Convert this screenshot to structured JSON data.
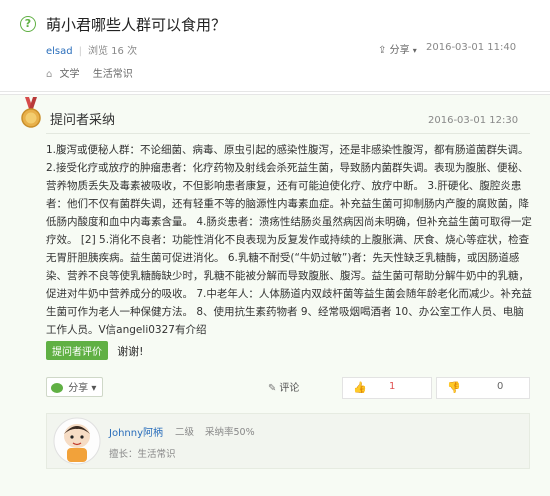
{
  "question": {
    "title": "萌小君哪些人群可以食用？",
    "user": "elsad",
    "views": "浏览 16 次",
    "share_label": "分享",
    "date": "2016-03-01 11:40",
    "tags": [
      "文学",
      "生活常识"
    ]
  },
  "answer": {
    "adopt_label": "提问者采纳",
    "date": "2016-03-01 12:30",
    "body": "1.腹泻或便秘人群：不论细菌、病毒、原虫引起的感染性腹泻，还是非感染性腹泻，都有肠道菌群失调。 2.接受化疗或放疗的肿瘤患者：化疗药物及射线会杀死益生菌，导致肠内菌群失调。表现为腹胀、便秘、营养物质丢失及毒素被吸收，不但影响患者康复，还有可能迫使化疗、放疗中断。 3.肝硬化、腹腔炎患者：他们不仅有菌群失调，还有轻重不等的脑源性内毒素血症。补充益生菌可抑制肠内产腹的腐败菌，降低肠内酸度和血中内毒素含量。 4.肠炎患者：溃疡性结肠炎虽然病因尚未明确，但补充益生菌可取得一定疗效。 [2] 5.消化不良者：功能性消化不良表现为反复发作或持续的上腹胀满、厌食、烧心等症状，检查无胃肝胆胰疾病。益生菌可促进消化。 6.乳糖不耐受(“牛奶过敏”)者：先天性缺乏乳糖酶，或因肠道感染、营养不良等使乳糖酶缺少时，乳糖不能被分解而导致腹胀、腹泻。益生菌可帮助分解牛奶中的乳糖，促进对牛奶中营养成分的吸收。 7.中老年人：人体肠道内双歧杆菌等益生菌会随年龄老化而减少。补充益生菌可作为老人一种保健方法。   8、使用抗生素药物者 9、经常吸烟喝酒者 10、办公室工作人员、电脑工作人员。V信angeli0327有介绍",
    "eval_button": "提问者评价",
    "thanks": "谢谢!",
    "share_label": "分享",
    "comment_label": "评论",
    "likes": "1",
    "dislikes": "0"
  },
  "answerer": {
    "name": "Johnny阿柄",
    "level": "二级",
    "adopt_rate": "采纳率50%",
    "specialty": "擅长：生活常识"
  },
  "colors": {
    "accent_green": "#60b044",
    "link_blue": "#2a6ebb",
    "like_red": "#e05252",
    "answer_bg": "#f7fbf4"
  },
  "icons": [
    "question-circle-icon",
    "share-icon",
    "tag-icon",
    "medal-icon",
    "wechat-icon",
    "comment-icon",
    "thumb-up-icon",
    "thumb-down-icon"
  ]
}
